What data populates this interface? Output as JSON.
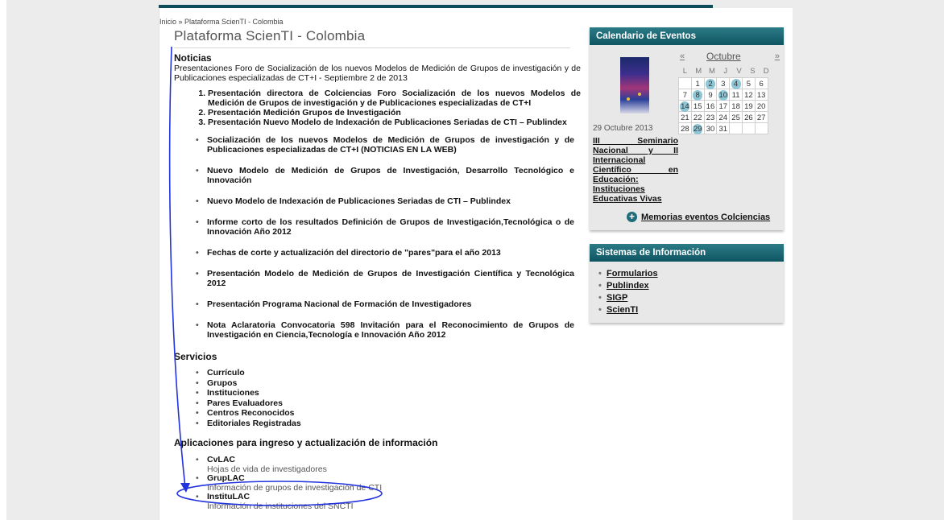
{
  "breadcrumb": "Inicio » Plataforma ScienTI - Colombia",
  "page_title": "Plataforma ScienTI - Colombia",
  "noticias": {
    "heading": "Noticias",
    "intro": "Presentaciones Foro de Socialización de los nuevos Modelos de Medición de Grupos de investigación y de Publicaciones especializadas de CT+I - Septiembre 2 de 2013",
    "presentaciones": [
      "Presentación directora de Colciencias Foro Socialización de los nuevos Modelos de Medición de Grupos de investigación y de Publicaciones especializadas de CT+I",
      "Presentación Medición Grupos de Investigación",
      "Presentación Nuevo Modelo de Indexación de Publicaciones Seriadas de CTI – Publindex"
    ],
    "items": [
      "Socialización de los nuevos Modelos de Medición de Grupos de investigación y de Publicaciones especializadas de CT+I (NOTICIAS EN LA WEB)",
      "Nuevo Modelo de Medición de Grupos de Investigación, Desarrollo Tecnológico e Innovación",
      "Nuevo Modelo de Indexación de Publicaciones Seriadas de CTI – Publindex",
      "Informe corto de los resultados Definición de Grupos de Investigación,Tecnológica o de Innovación Año 2012",
      "Fechas de corte y actualización del directorio de \"pares\"para el año 2013",
      "Presentación Modelo de Medición de Grupos de Investigación Científica y Tecnológica 2012",
      "Presentación Programa Nacional de Formación de Investigadores",
      "Nota Aclaratoria Convocatoria 598 Invitación para el Reconocimiento de Grupos de Investigación en Ciencia,Tecnología e Innovación Año 2012"
    ]
  },
  "servicios": {
    "heading": "Servicios",
    "items": [
      "Currículo",
      "Grupos",
      "Instituciones",
      "Pares Evaluadores",
      "Centros Reconocidos",
      "Editoriales Registradas"
    ]
  },
  "aplicaciones": {
    "heading": "Aplicaciones para ingreso y actualización de información",
    "items": [
      {
        "name": "CvLAC",
        "desc": "Hojas de vida de investigadores"
      },
      {
        "name": "GrupLAC",
        "desc": "Información de grupos de investigación de CTI"
      },
      {
        "name": "InstituLAC",
        "desc": "Información de instituciones del SNCTI"
      }
    ]
  },
  "calendario": {
    "title": "Calendario de Eventos",
    "prev": "«",
    "next": "»",
    "month": "Octubre",
    "dow": [
      "L",
      "M",
      "M",
      "J",
      "V",
      "S",
      "D"
    ],
    "weeks": [
      [
        "",
        "1",
        "2",
        "3",
        "4",
        "5",
        "6"
      ],
      [
        "7",
        "8",
        "9",
        "10",
        "11",
        "12",
        "13"
      ],
      [
        "14",
        "15",
        "16",
        "17",
        "18",
        "19",
        "20"
      ],
      [
        "21",
        "22",
        "23",
        "24",
        "25",
        "26",
        "27"
      ],
      [
        "28",
        "29",
        "30",
        "31",
        "",
        "",
        ""
      ]
    ],
    "event_days": [
      "2",
      "4",
      "8",
      "10",
      "14",
      "29"
    ],
    "event_date": "29 Octubre 2013",
    "event_title": "III Seminario Nacional y II Internacional Científico en Educación: Instituciones Educativas Vivas",
    "memorias_link": "Memorias eventos Colciencias"
  },
  "sistemas": {
    "title": "Sistemas de Información",
    "items": [
      "Formularios",
      "Publindex",
      "SIGP",
      "ScienTI"
    ]
  },
  "annotation_color": "#2233dd"
}
